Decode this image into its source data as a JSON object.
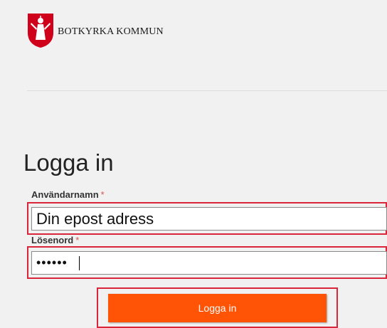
{
  "header": {
    "brand_name": "BOTKYRKA KOMMUN",
    "logo_icon": "botkyrka-coat-of-arms",
    "logo_color": "#d0021b"
  },
  "login": {
    "title": "Logga in",
    "username": {
      "label": "Användarnamn",
      "required_mark": "*",
      "value": "Din epost adress"
    },
    "password": {
      "label": "Lösenord",
      "required_mark": "*",
      "value": "••••••"
    },
    "submit_label": "Logga in"
  },
  "colors": {
    "button": "#ff5306",
    "highlight": "#d9263a",
    "required": "#d9534f"
  }
}
